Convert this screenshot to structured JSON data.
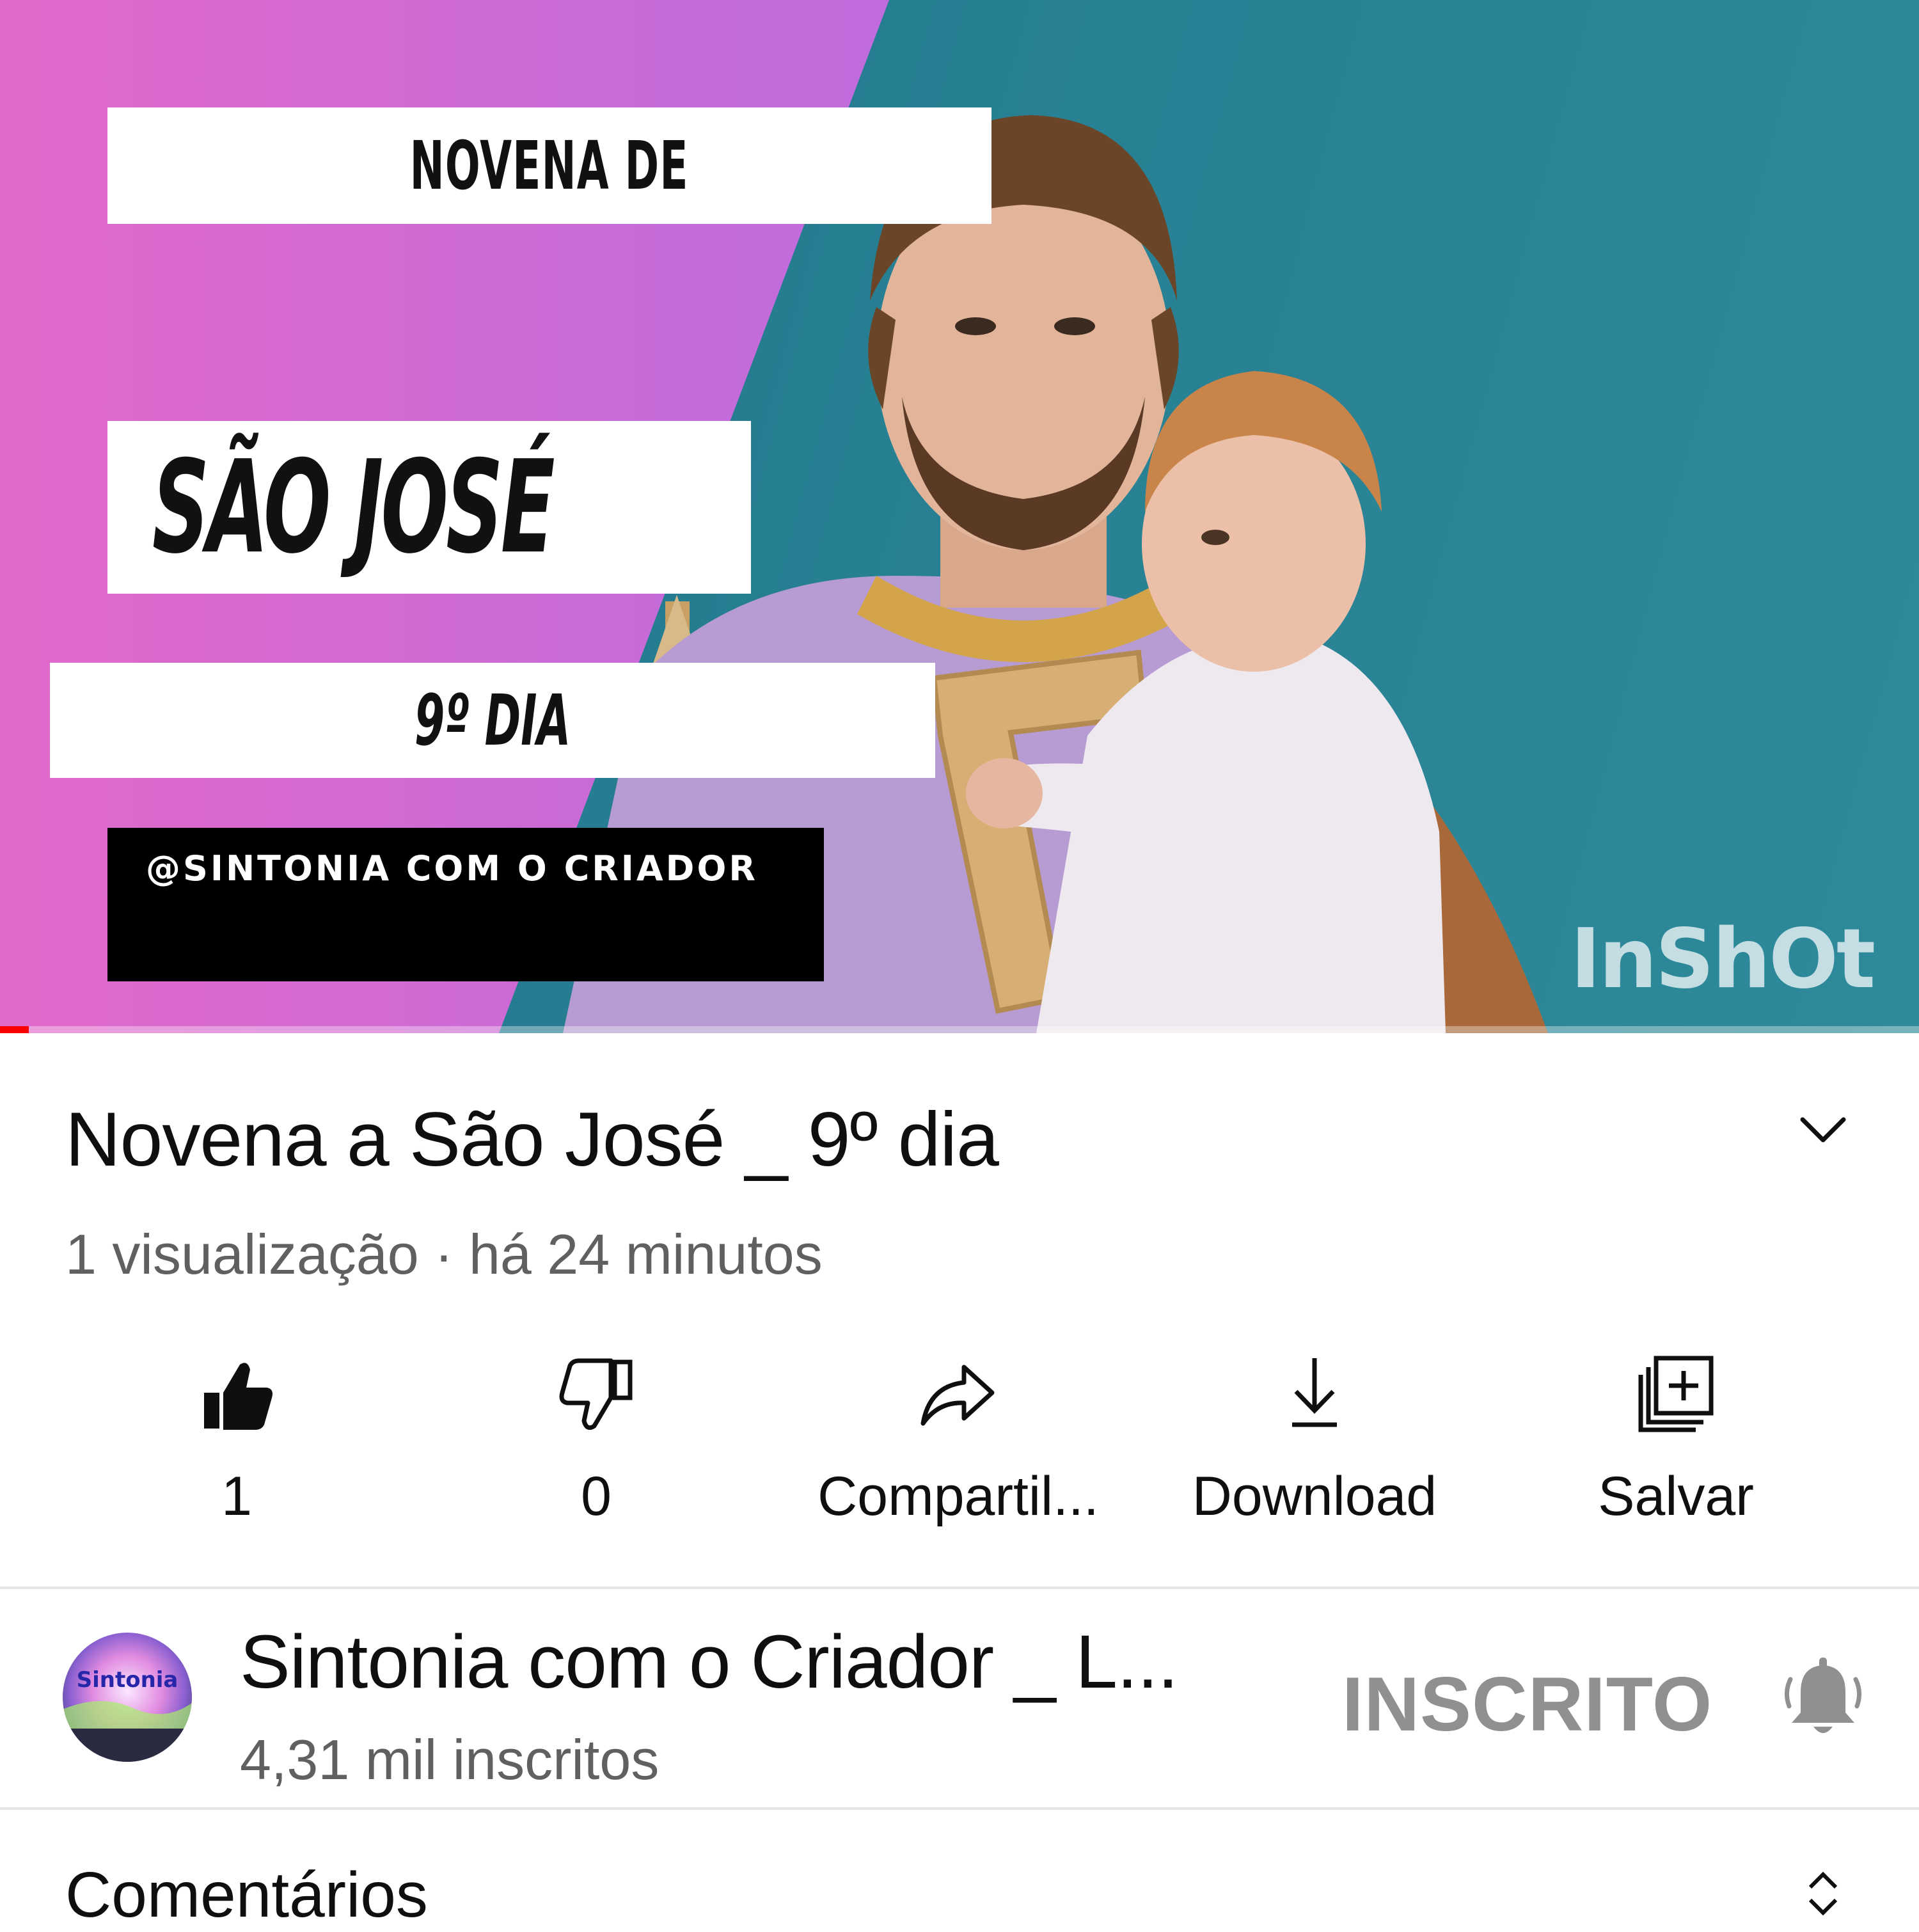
{
  "thumbnail": {
    "line1": "NOVENA DE",
    "line2": "SÃO JOSÉ",
    "line3": "9º DIA",
    "handle": "@SINTONIA COM O CRIADOR",
    "watermark": "InShOt"
  },
  "player": {
    "progress_fraction": 0.015,
    "progress_color": "#ff0000"
  },
  "video": {
    "title": "Novena a São José _ 9º dia",
    "meta": "1 visualização · há 24 minutos"
  },
  "actions": [
    {
      "icon": "thumbs-up-icon",
      "label": "1"
    },
    {
      "icon": "thumbs-down-icon",
      "label": "0"
    },
    {
      "icon": "share-icon",
      "label": "Compartil..."
    },
    {
      "icon": "download-icon",
      "label": "Download"
    },
    {
      "icon": "save-playlist-icon",
      "label": "Salvar"
    }
  ],
  "channel": {
    "avatar_text": "Sintonia",
    "name": "Sintonia com o Criador _ L...",
    "subscribers": "4,31 mil inscritos",
    "subscribe_label": "INSCRITO"
  },
  "comments": {
    "label": "Comentários"
  },
  "colors": {
    "text_primary": "#0f0f0f",
    "text_secondary": "#606060",
    "subscribed_grey": "#909090"
  }
}
